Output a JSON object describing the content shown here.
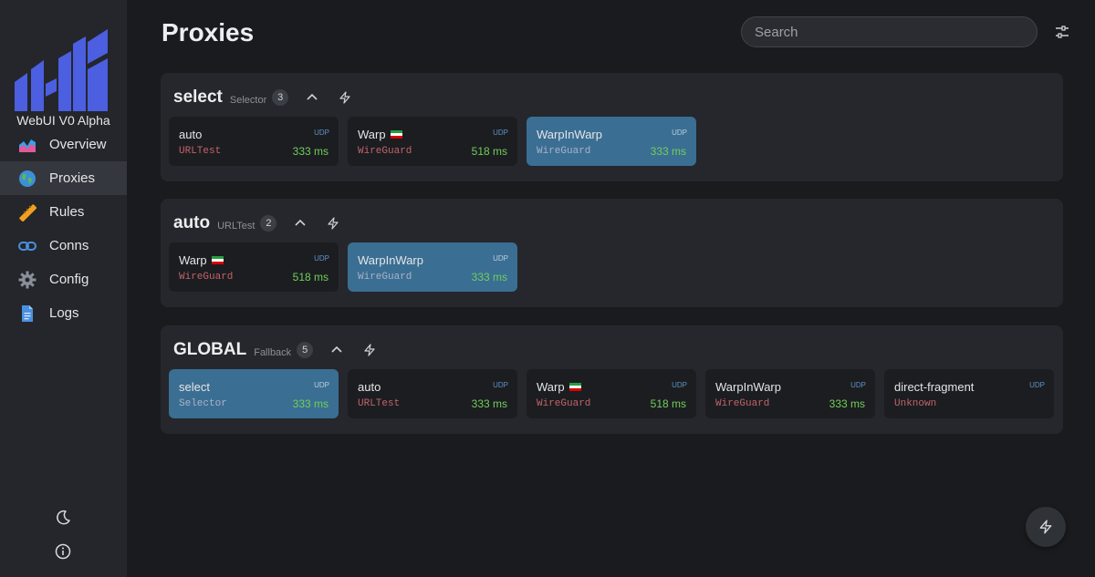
{
  "app": {
    "brand": "WebUI V0 Alpha",
    "accent": "#4b5fe0"
  },
  "nav": [
    {
      "label": "Overview",
      "icon": "chart-area-icon"
    },
    {
      "label": "Proxies",
      "icon": "globe-icon",
      "active": true
    },
    {
      "label": "Rules",
      "icon": "ruler-icon"
    },
    {
      "label": "Conns",
      "icon": "link-icon"
    },
    {
      "label": "Config",
      "icon": "gear-icon"
    },
    {
      "label": "Logs",
      "icon": "document-icon"
    }
  ],
  "header": {
    "title": "Proxies",
    "search_placeholder": "Search"
  },
  "groups": [
    {
      "name": "select",
      "type": "Selector",
      "count": "3",
      "proxies": [
        {
          "name": "auto",
          "type": "URLTest",
          "udp": "UDP",
          "delay": "333 ms"
        },
        {
          "name": "Warp",
          "flag": true,
          "type": "WireGuard",
          "udp": "UDP",
          "delay": "518 ms"
        },
        {
          "name": "WarpInWarp",
          "type": "WireGuard",
          "udp": "UDP",
          "delay": "333 ms",
          "selected": true
        }
      ]
    },
    {
      "name": "auto",
      "type": "URLTest",
      "count": "2",
      "proxies": [
        {
          "name": "Warp",
          "flag": true,
          "type": "WireGuard",
          "udp": "UDP",
          "delay": "518 ms"
        },
        {
          "name": "WarpInWarp",
          "type": "WireGuard",
          "udp": "UDP",
          "delay": "333 ms",
          "selected": true
        }
      ]
    },
    {
      "name": "GLOBAL",
      "type": "Fallback",
      "count": "5",
      "proxies": [
        {
          "name": "select",
          "type": "Selector",
          "udp": "UDP",
          "delay": "333 ms",
          "selected": true
        },
        {
          "name": "auto",
          "type": "URLTest",
          "udp": "UDP",
          "delay": "333 ms"
        },
        {
          "name": "Warp",
          "flag": true,
          "type": "WireGuard",
          "udp": "UDP",
          "delay": "518 ms"
        },
        {
          "name": "WarpInWarp",
          "type": "WireGuard",
          "udp": "UDP",
          "delay": "333 ms"
        },
        {
          "name": "direct-fragment",
          "type": "Unknown",
          "udp": "UDP",
          "delay": ""
        }
      ]
    }
  ]
}
